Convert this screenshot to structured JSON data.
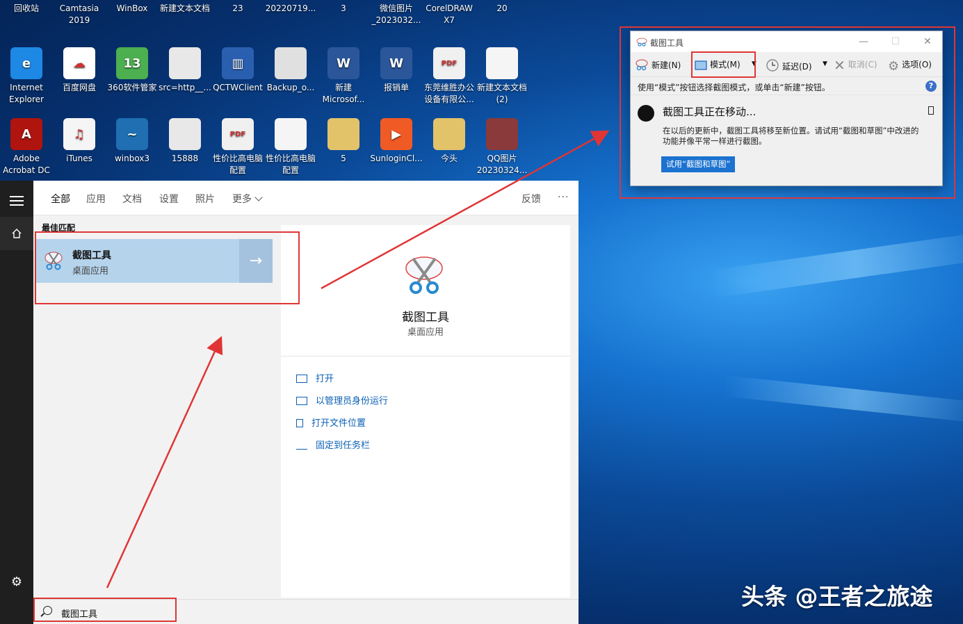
{
  "desktop": {
    "row0": [
      {
        "label": "回收站",
        "color": "#8a9bb0"
      },
      {
        "label": "Camtasia 2019",
        "color": "#2ea44f"
      },
      {
        "label": "WinBox",
        "color": "#1f6fb2"
      },
      {
        "label": "新建文本文档",
        "color": "#f5f5f5"
      },
      {
        "label": "23",
        "color": "#b5523b"
      },
      {
        "label": "20220719...",
        "color": "#5a7a3a"
      },
      {
        "label": "3",
        "color": "#e2c36a"
      },
      {
        "label": "微信图片 _2023032...",
        "color": "#f5f5f5"
      },
      {
        "label": "CorelDRAW X7",
        "color": "#3aa84a"
      },
      {
        "label": "20",
        "color": "#b84a3a"
      }
    ],
    "row1": [
      {
        "label": "Internet Explorer",
        "color": "#1e88e5",
        "glyph": "e"
      },
      {
        "label": "百度网盘",
        "color": "#ffffff",
        "glyph": "☁"
      },
      {
        "label": "360软件管家",
        "color": "#4caf50",
        "glyph": "13"
      },
      {
        "label": "src=http__...",
        "color": "#e8e8e8",
        "glyph": ""
      },
      {
        "label": "QCTWClient",
        "color": "#2a5fb0",
        "glyph": "▥"
      },
      {
        "label": "Backup_o...",
        "color": "#e0e0e0",
        "glyph": ""
      },
      {
        "label": "新建 Microsof...",
        "color": "#2b579a",
        "glyph": "W"
      },
      {
        "label": "报销单",
        "color": "#2b579a",
        "glyph": "W"
      },
      {
        "label": "东莞维胜办公设备有限公...",
        "color": "#f0f0f0",
        "glyph": "PDF"
      },
      {
        "label": "新建文本文档 (2)",
        "color": "#f5f5f5",
        "glyph": ""
      }
    ],
    "row2": [
      {
        "label": "Adobe Acrobat DC",
        "color": "#b0140e",
        "glyph": "A"
      },
      {
        "label": "iTunes",
        "color": "#f5f5f5",
        "glyph": "♫"
      },
      {
        "label": "winbox3",
        "color": "#1f6fb2",
        "glyph": "~"
      },
      {
        "label": "15888",
        "color": "#e8e8e8",
        "glyph": ""
      },
      {
        "label": "性价比高电脑配置",
        "color": "#f0f0f0",
        "glyph": "PDF"
      },
      {
        "label": "性价比高电脑配置",
        "color": "#f5f5f5",
        "glyph": ""
      },
      {
        "label": "5",
        "color": "#e2c36a",
        "glyph": ""
      },
      {
        "label": "SunloginCl...",
        "color": "#f05a24",
        "glyph": "▶"
      },
      {
        "label": "今头",
        "color": "#e2c36a",
        "glyph": ""
      },
      {
        "label": "QQ图片 20230324...",
        "color": "#8a3a3a",
        "glyph": ""
      }
    ]
  },
  "start_menu": {
    "tabs": [
      "全部",
      "应用",
      "文档",
      "设置",
      "照片",
      "更多"
    ],
    "feedback": "反馈",
    "more_dots": "···",
    "best_match_label": "最佳匹配",
    "best_match": {
      "name": "截图工具",
      "subtitle": "桌面应用"
    },
    "detail": {
      "name": "截图工具",
      "subtitle": "桌面应用"
    },
    "actions": [
      "打开",
      "以管理员身份运行",
      "打开文件位置",
      "固定到任务栏"
    ],
    "search_value": "截图工具"
  },
  "snipping_tool": {
    "title": "截图工具",
    "toolbar": {
      "new": "新建(N)",
      "mode": "模式(M)",
      "delay": "延迟(D)",
      "cancel": "取消(C)",
      "options": "选项(O)"
    },
    "info": "使用“模式”按钮选择截图模式，或单击“新建”按钮。",
    "notice_title": "截图工具正在移动...",
    "notice_body": "在以后的更新中，截图工具将移至新位置。请试用“截图和草图”中改进的功能并像平常一样进行截图。",
    "notice_button": "试用“截图和草图”"
  },
  "watermark": "头条 @王者之旅途",
  "colors": {
    "accent": "#0a64c8",
    "annotation": "#e03535",
    "selection": "#b6d3ec"
  }
}
